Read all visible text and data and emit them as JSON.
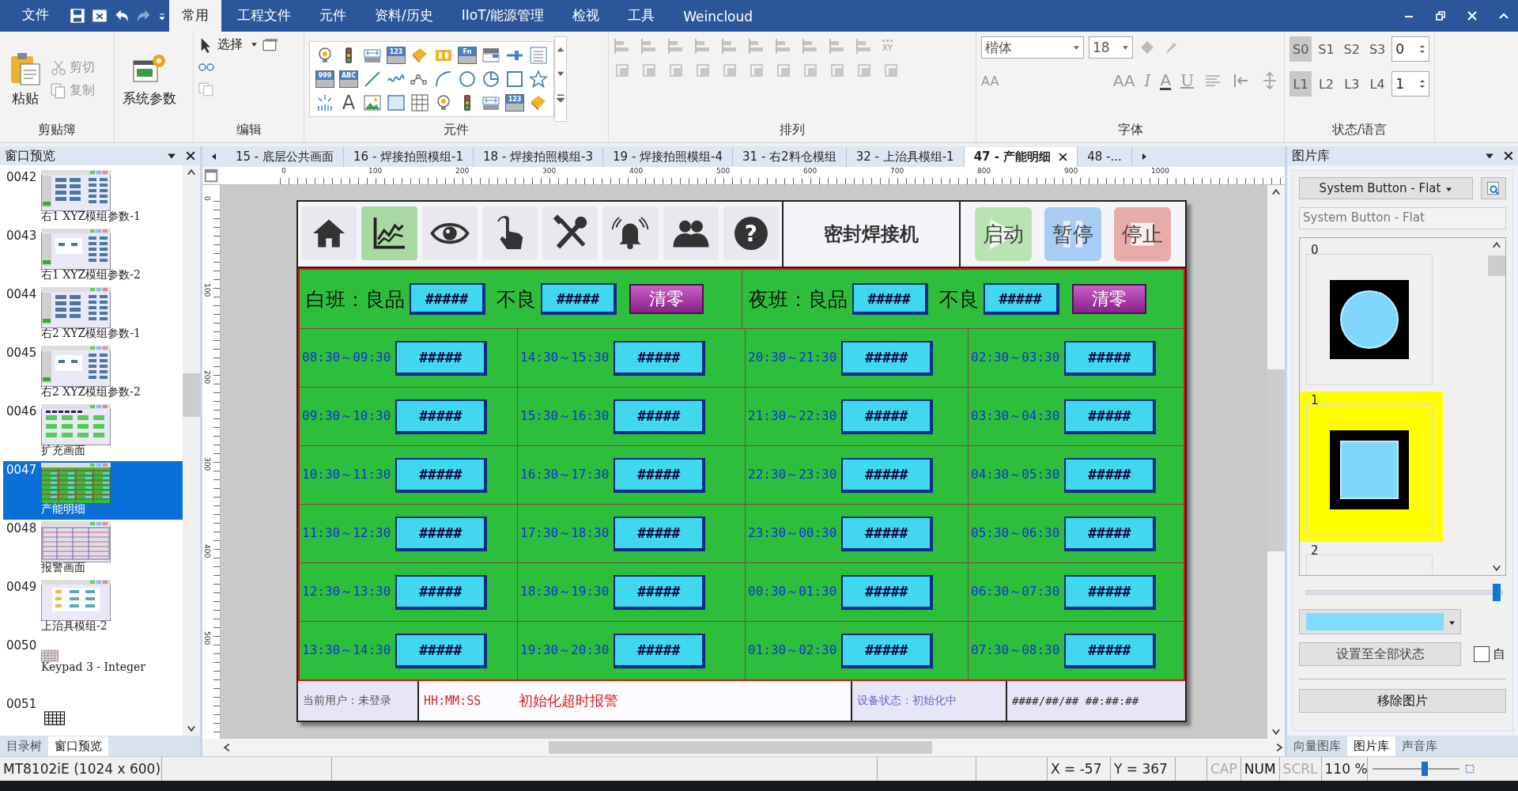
{
  "menu": {
    "file": "文件",
    "tabs": [
      {
        "label": "常用",
        "selected": true
      },
      {
        "label": "工程文件",
        "selected": false
      },
      {
        "label": "元件",
        "selected": false
      },
      {
        "label": "资料/历史",
        "selected": false
      },
      {
        "label": "IIoT/能源管理",
        "selected": false
      },
      {
        "label": "检视",
        "selected": false
      },
      {
        "label": "工具",
        "selected": false
      },
      {
        "label": "Weincloud",
        "selected": false
      }
    ]
  },
  "ribbon": {
    "clipboard": {
      "paste": "粘贴",
      "cut": "剪切",
      "copy": "复制",
      "label": "剪贴簿"
    },
    "system": {
      "button": "系统参数"
    },
    "edit": {
      "select": "选择",
      "label": "编辑"
    },
    "elements": {
      "label": "元件",
      "gallery": [
        {
          "kind": "bulb"
        },
        {
          "kind": "lights"
        },
        {
          "kind": "meter"
        },
        {
          "kind": "glyph",
          "glyph": "123"
        },
        {
          "kind": "tag"
        },
        {
          "kind": "toggle"
        },
        {
          "kind": "glyph",
          "glyph": "Fn"
        },
        {
          "kind": "combo"
        },
        {
          "kind": "slider"
        },
        {
          "kind": "list"
        },
        {
          "kind": "glyph",
          "glyph": "999"
        },
        {
          "kind": "glyph",
          "glyph": "ABC"
        },
        {
          "kind": "line"
        },
        {
          "kind": "wave"
        },
        {
          "kind": "polyline"
        },
        {
          "kind": "arc"
        },
        {
          "kind": "circle"
        },
        {
          "kind": "pie"
        },
        {
          "kind": "rect"
        },
        {
          "kind": "star"
        },
        {
          "kind": "burst"
        },
        {
          "kind": "letter",
          "glyph": "A"
        },
        {
          "kind": "image"
        },
        {
          "kind": "frame"
        },
        {
          "kind": "table"
        },
        {
          "kind": "bulb"
        },
        {
          "kind": "lights"
        },
        {
          "kind": "meter"
        },
        {
          "kind": "glyph",
          "glyph": "123"
        },
        {
          "kind": "tag"
        }
      ]
    },
    "arrange": {
      "label": "排列",
      "xy": "XY"
    },
    "font": {
      "label": "字体",
      "family": "楷体",
      "size": "18",
      "tools": [
        {
          "kind": "grow",
          "glyph": "AA"
        },
        {
          "kind": "shrink",
          "glyph": "AA"
        },
        {
          "kind": "italic",
          "glyph": "I"
        },
        {
          "kind": "color",
          "glyph": "A"
        },
        {
          "kind": "underline",
          "glyph": "U"
        }
      ]
    },
    "state": {
      "label": "状态/语言",
      "states": [
        {
          "label": "S0",
          "selected": true
        },
        {
          "label": "S1",
          "selected": false
        },
        {
          "label": "S2",
          "selected": false
        },
        {
          "label": "S3",
          "selected": false
        }
      ],
      "state_value": "0",
      "languages": [
        {
          "label": "L1",
          "selected": true
        },
        {
          "label": "L2",
          "selected": false
        },
        {
          "label": "L3",
          "selected": false
        },
        {
          "label": "L4",
          "selected": false
        }
      ],
      "language_value": "1"
    }
  },
  "left_panel": {
    "title": "窗口预览",
    "items": [
      {
        "number": "0042",
        "label": "右1 XYZ模组参数-1",
        "kind": "grid",
        "selected": false
      },
      {
        "number": "0043",
        "label": "右1 XYZ模组参数-2",
        "kind": "split",
        "selected": false
      },
      {
        "number": "0044",
        "label": "右2 XYZ模组参数-1",
        "kind": "grid",
        "selected": false
      },
      {
        "number": "0045",
        "label": "右2 XYZ模组参数-2",
        "kind": "split",
        "selected": false
      },
      {
        "number": "0046",
        "label": "扩充画面",
        "kind": "buttons",
        "selected": false
      },
      {
        "number": "0047",
        "label": "产能明细",
        "kind": "production",
        "selected": true
      },
      {
        "number": "0048",
        "label": "报警画面",
        "kind": "table",
        "selected": false
      },
      {
        "number": "0049",
        "label": "上治具模组-2",
        "kind": "flow",
        "selected": false
      },
      {
        "number": "0050",
        "label": "Keypad 3 - Integer",
        "kind": "keys-small",
        "selected": false
      },
      {
        "number": "0051",
        "kind": "keys",
        "selected": false
      }
    ],
    "tabs": [
      {
        "label": "目录树",
        "selected": false
      },
      {
        "label": "窗口预览",
        "selected": true
      }
    ]
  },
  "doc_tabs": [
    {
      "label": "15 - 底层公共画面",
      "selected": false
    },
    {
      "label": "16 - 焊接拍照模组-1",
      "selected": false
    },
    {
      "label": "18 - 焊接拍照模组-3",
      "selected": false
    },
    {
      "label": "19 - 焊接拍照模组-4",
      "selected": false
    },
    {
      "label": "31 - 右2料仓模组",
      "selected": false
    },
    {
      "label": "32 - 上治具模组-1",
      "selected": false
    },
    {
      "label": "47 - 产能明细",
      "selected": true
    },
    {
      "label": "48 -...",
      "selected": false
    }
  ],
  "ruler": {
    "x_labels": [
      "0",
      "100",
      "200",
      "300",
      "400",
      "500",
      "600",
      "700",
      "800",
      "900",
      "1000"
    ],
    "y_labels": [
      "0",
      "100",
      "200",
      "300",
      "400",
      "500"
    ]
  },
  "hmi": {
    "nav": [
      {
        "kind": "home",
        "selected": false
      },
      {
        "kind": "chart",
        "selected": true
      },
      {
        "kind": "eye",
        "selected": false
      },
      {
        "kind": "hand",
        "selected": false
      },
      {
        "kind": "tools",
        "selected": false
      },
      {
        "kind": "bell",
        "selected": false
      },
      {
        "kind": "people",
        "selected": false
      },
      {
        "kind": "help",
        "glyph": "?",
        "selected": false
      }
    ],
    "title": "密封焊接机",
    "actions": [
      {
        "label": "启动",
        "kind": "start",
        "color": "#b9e3b2"
      },
      {
        "label": "暂停",
        "kind": "pause",
        "color": "#a7cdf7"
      },
      {
        "label": "停止",
        "kind": "stop",
        "color": "#e9aaaa"
      }
    ],
    "shifts": [
      {
        "label": "白班：良品",
        "good": "#####",
        "defect_label": "不良",
        "defect": "#####",
        "clear": "清零"
      },
      {
        "label": "夜班：良品",
        "good": "#####",
        "defect_label": "不良",
        "defect": "#####",
        "clear": "清零"
      }
    ],
    "slots": [
      [
        {
          "time": "08:30～09:30",
          "value": "#####"
        },
        {
          "time": "14:30～15:30",
          "value": "#####"
        },
        {
          "time": "20:30～21:30",
          "value": "#####"
        },
        {
          "time": "02:30～03:30",
          "value": "#####"
        }
      ],
      [
        {
          "time": "09:30～10:30",
          "value": "#####"
        },
        {
          "time": "15:30～16:30",
          "value": "#####"
        },
        {
          "time": "21:30～22:30",
          "value": "#####"
        },
        {
          "time": "03:30～04:30",
          "value": "#####"
        }
      ],
      [
        {
          "time": "10:30～11:30",
          "value": "#####"
        },
        {
          "time": "16:30～17:30",
          "value": "#####"
        },
        {
          "time": "22:30～23:30",
          "value": "#####"
        },
        {
          "time": "04:30～05:30",
          "value": "#####"
        }
      ],
      [
        {
          "time": "11:30～12:30",
          "value": "#####"
        },
        {
          "time": "17:30～18:30",
          "value": "#####"
        },
        {
          "time": "23:30～00:30",
          "value": "#####"
        },
        {
          "time": "05:30～06:30",
          "value": "#####"
        }
      ],
      [
        {
          "time": "12:30～13:30",
          "value": "#####"
        },
        {
          "time": "18:30～19:30",
          "value": "#####"
        },
        {
          "time": "00:30～01:30",
          "value": "#####"
        },
        {
          "time": "06:30～07:30",
          "value": "#####"
        }
      ],
      [
        {
          "time": "13:30～14:30",
          "value": "#####"
        },
        {
          "time": "19:30～20:30",
          "value": "#####"
        },
        {
          "time": "01:30～02:30",
          "value": "#####"
        },
        {
          "time": "07:30～08:30",
          "value": "#####"
        }
      ]
    ],
    "status": {
      "user": "当前用户：未登录",
      "time": "HH:MM:SS",
      "alarm": "初始化超时报警",
      "device": "设备状态：初始化中",
      "datetime": "####/##/## ##:##:##"
    }
  },
  "right_panel": {
    "title": "图片库",
    "library": "System Button - Flat",
    "library_name": "System Button - Flat",
    "images": [
      {
        "index": "0",
        "kind": "circle",
        "selected": false
      },
      {
        "index": "1",
        "kind": "square",
        "selected": true
      },
      {
        "index": "2",
        "kind": "empty",
        "selected": false
      }
    ],
    "size_slider": {
      "level": 0.97
    },
    "apply_button": "设置至全部状态",
    "auto": {
      "label": "自",
      "checked": false
    },
    "remove_button": "移除图片",
    "tabs": [
      {
        "label": "向量图库",
        "selected": false
      },
      {
        "label": "图片库",
        "selected": true
      },
      {
        "label": "声音库",
        "selected": false
      }
    ]
  },
  "status_bar": {
    "model": "MT8102iE (1024 x 600)",
    "x": "X = -57",
    "y": "Y = 367",
    "indicators": [
      {
        "label": "CAP",
        "on": false
      },
      {
        "label": "NUM",
        "on": true
      },
      {
        "label": "SCRL",
        "on": false
      }
    ],
    "zoom": "110 %",
    "zoom_slider": {
      "level": 0.6
    }
  }
}
